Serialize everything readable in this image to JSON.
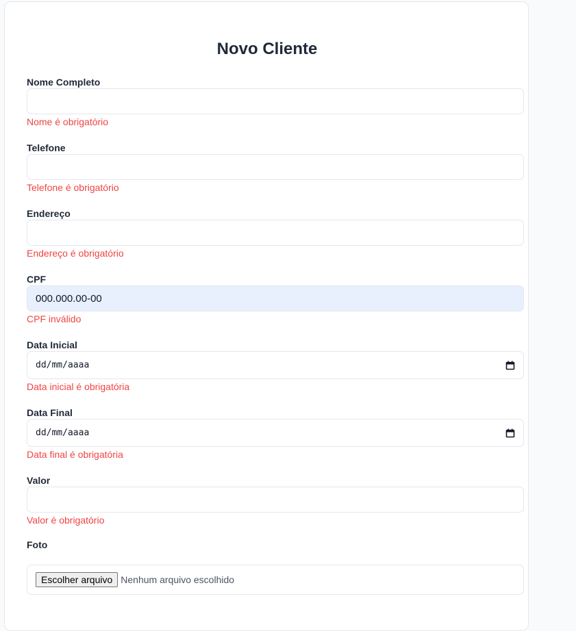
{
  "form": {
    "title": "Novo Cliente",
    "fields": {
      "nome": {
        "label": "Nome Completo",
        "value": "",
        "error": "Nome é obrigatório"
      },
      "telefone": {
        "label": "Telefone",
        "value": "",
        "error": "Telefone é obrigatório"
      },
      "endereco": {
        "label": "Endereço",
        "value": "",
        "error": "Endereço é obrigatório"
      },
      "cpf": {
        "label": "CPF",
        "value": "000.000.00-00",
        "error": "CPF inválido"
      },
      "data_inicial": {
        "label": "Data Inicial",
        "placeholder": "dd/mm/aaaa",
        "error": "Data inicial é obrigatória"
      },
      "data_final": {
        "label": "Data Final",
        "placeholder": "dd/mm/aaaa",
        "error": "Data final é obrigatória"
      },
      "valor": {
        "label": "Valor",
        "value": "",
        "error": "Valor é obrigatório"
      },
      "foto": {
        "label": "Foto",
        "button_label": "Escolher arquivo",
        "status": "Nenhum arquivo escolhido"
      }
    }
  },
  "icons": {
    "calendar": "calendar-icon"
  },
  "colors": {
    "error": "#ef4444",
    "autofill_bg": "#e8f0fe",
    "title": "#1f2937"
  }
}
